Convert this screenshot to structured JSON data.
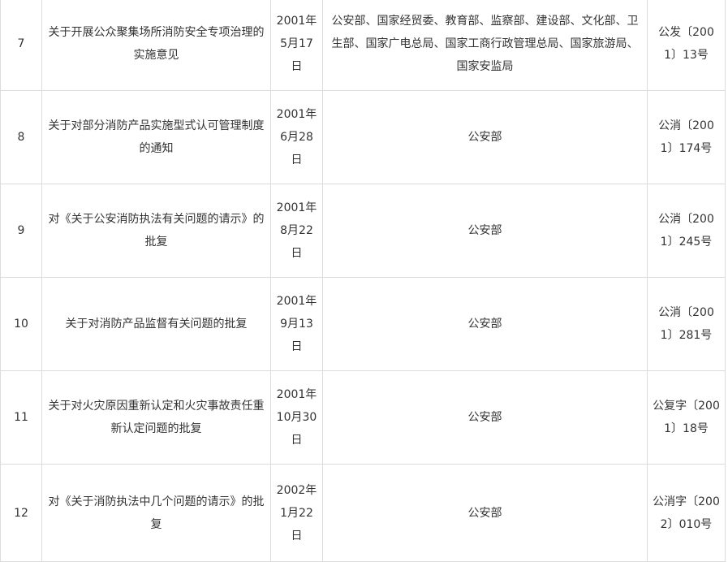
{
  "rows": [
    {
      "no": "7",
      "title": "关于开展公众聚集场所消防安全专项治理的实施意见",
      "date": "2001年5月17日",
      "issuer": "公安部、国家经贸委、教育部、监察部、建设部、文化部、卫生部、国家广电总局、国家工商行政管理总局、国家旅游局、国家安监局",
      "code": "公发〔2001〕13号"
    },
    {
      "no": "8",
      "title": "关于对部分消防产品实施型式认可管理制度的通知",
      "date": "2001年6月28日",
      "issuer": "公安部",
      "code": "公消〔2001〕174号"
    },
    {
      "no": "9",
      "title": "对《关于公安消防执法有关问题的请示》的批复",
      "date": "2001年8月22日",
      "issuer": "公安部",
      "code": "公消〔2001〕245号"
    },
    {
      "no": "10",
      "title": "关于对消防产品监督有关问题的批复",
      "date": "2001年9月13日",
      "issuer": "公安部",
      "code": "公消〔2001〕281号"
    },
    {
      "no": "11",
      "title": "关于对火灾原因重新认定和火灾事故责任重新认定问题的批复",
      "date": "2001年10月30日",
      "issuer": "公安部",
      "code": "公复字〔2001〕18号"
    },
    {
      "no": "12",
      "title": "对《关于消防执法中几个问题的请示》的批复",
      "date": "2002年1月22日",
      "issuer": "公安部",
      "code": "公消字〔2002〕010号"
    }
  ]
}
